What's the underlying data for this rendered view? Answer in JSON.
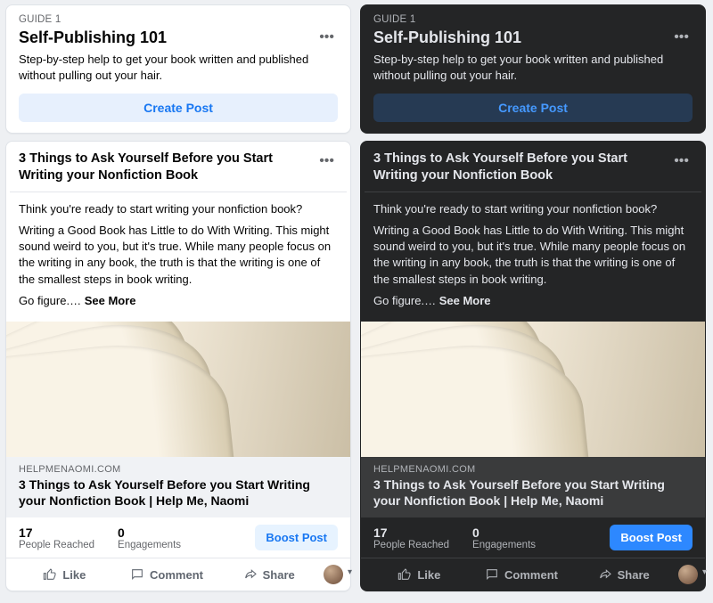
{
  "guide": {
    "label": "GUIDE 1",
    "title": "Self-Publishing 101",
    "desc": "Step-by-step help to get your book written and published without pulling out your hair.",
    "create": "Create Post"
  },
  "post": {
    "title": "3 Things to Ask Yourself Before you Start Writing your Nonfiction Book",
    "p1": "Think you're ready to start writing your nonfiction book?",
    "p2": "Writing a Good Book has Little to do With Writing. This might sound weird to you, but it's true. While many people focus on the writing in any book, the truth is that the writing is one of the smallest steps in book writing.",
    "p3_prefix": "Go figure.…",
    "seemore": " See More",
    "link_domain": "HELPMENAOMI.COM",
    "link_title": "3 Things to Ask Yourself Before you Start Writing your Nonfiction Book | Help Me, Naomi",
    "reach_n": "17",
    "reach_l": "People Reached",
    "eng_n": "0",
    "eng_l": "Engagements",
    "boost": "Boost Post",
    "like": "Like",
    "comment": "Comment",
    "share": "Share"
  }
}
